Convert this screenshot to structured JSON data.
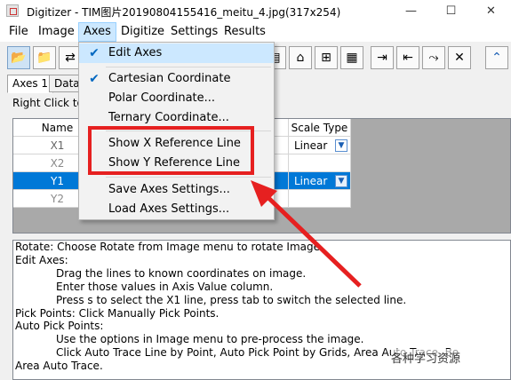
{
  "window": {
    "title": "Digitizer - TIM图片20190804155416_meitu_4.jpg(317x254)",
    "minimize": "—",
    "maximize": "☐",
    "close": "✕"
  },
  "menubar": [
    "File",
    "Image",
    "Axes",
    "Digitize",
    "Settings",
    "Results"
  ],
  "toolbar": {
    "icons": [
      "open-icon",
      "open-folder-icon",
      "import-icon",
      "page-icon",
      "tag-icon",
      "add-point-icon",
      "grid-icon",
      "export-left-icon",
      "export-right-icon",
      "curve-icon",
      "delete-icon",
      "collapse-icon"
    ],
    "glyphs": [
      "📂",
      "📁",
      "⇄",
      "▤",
      "⌂",
      "⊞",
      "▦",
      "⇥",
      "⇤",
      "⤳",
      "✕",
      "⌃"
    ]
  },
  "tabs": [
    "Axes 1",
    "Data"
  ],
  "hint": "Right Click to",
  "grid": {
    "name_header": "Name",
    "scale_header": "Scale Type",
    "rows": [
      {
        "name": "X1",
        "scale": "Linear",
        "selected": false
      },
      {
        "name": "X2",
        "scale": "",
        "selected": false
      },
      {
        "name": "Y1",
        "scale": "Linear",
        "selected": true
      },
      {
        "name": "Y2",
        "scale": "",
        "selected": false
      }
    ]
  },
  "axes_menu": {
    "items": [
      {
        "label": "Edit Axes",
        "checked": true
      },
      {
        "label": "Cartesian Coordinate",
        "checked": true
      },
      {
        "label": "Polar Coordinate...",
        "checked": false
      },
      {
        "label": "Ternary Coordinate...",
        "checked": false
      },
      {
        "label": "Show X Reference Line",
        "checked": false
      },
      {
        "label": "Show Y Reference Line",
        "checked": false
      },
      {
        "label": "Save Axes Settings...",
        "checked": false
      },
      {
        "label": "Load Axes Settings...",
        "checked": false
      }
    ]
  },
  "description": [
    {
      "text": "Rotate: Choose Rotate from Image menu to rotate Image.",
      "indent": 0
    },
    {
      "text": "Edit Axes:",
      "indent": 0
    },
    {
      "text": "Drag the lines to known coordinates on image.",
      "indent": 1
    },
    {
      "text": "Enter those values in Axis Value column.",
      "indent": 1
    },
    {
      "text": "Press s to select the X1 line, press tab to switch the selected line.",
      "indent": 1
    },
    {
      "text": "Pick Points: Click Manually Pick Points.",
      "indent": 0
    },
    {
      "text": "Auto Pick Points:",
      "indent": 0
    },
    {
      "text": "Use the options in Image menu to pre-process the image.",
      "indent": 1
    },
    {
      "text": "Click Auto Trace Line by Point, Auto Pick Point by Grids, Area Auto Trace, Bo",
      "indent": 1
    },
    {
      "text": "Area Auto Trace.",
      "indent": 0
    }
  ],
  "watermark": "各种学习资源",
  "colors": {
    "highlight": "#0078d7",
    "annotation": "#e62020",
    "menu_hover": "#cce8ff"
  }
}
